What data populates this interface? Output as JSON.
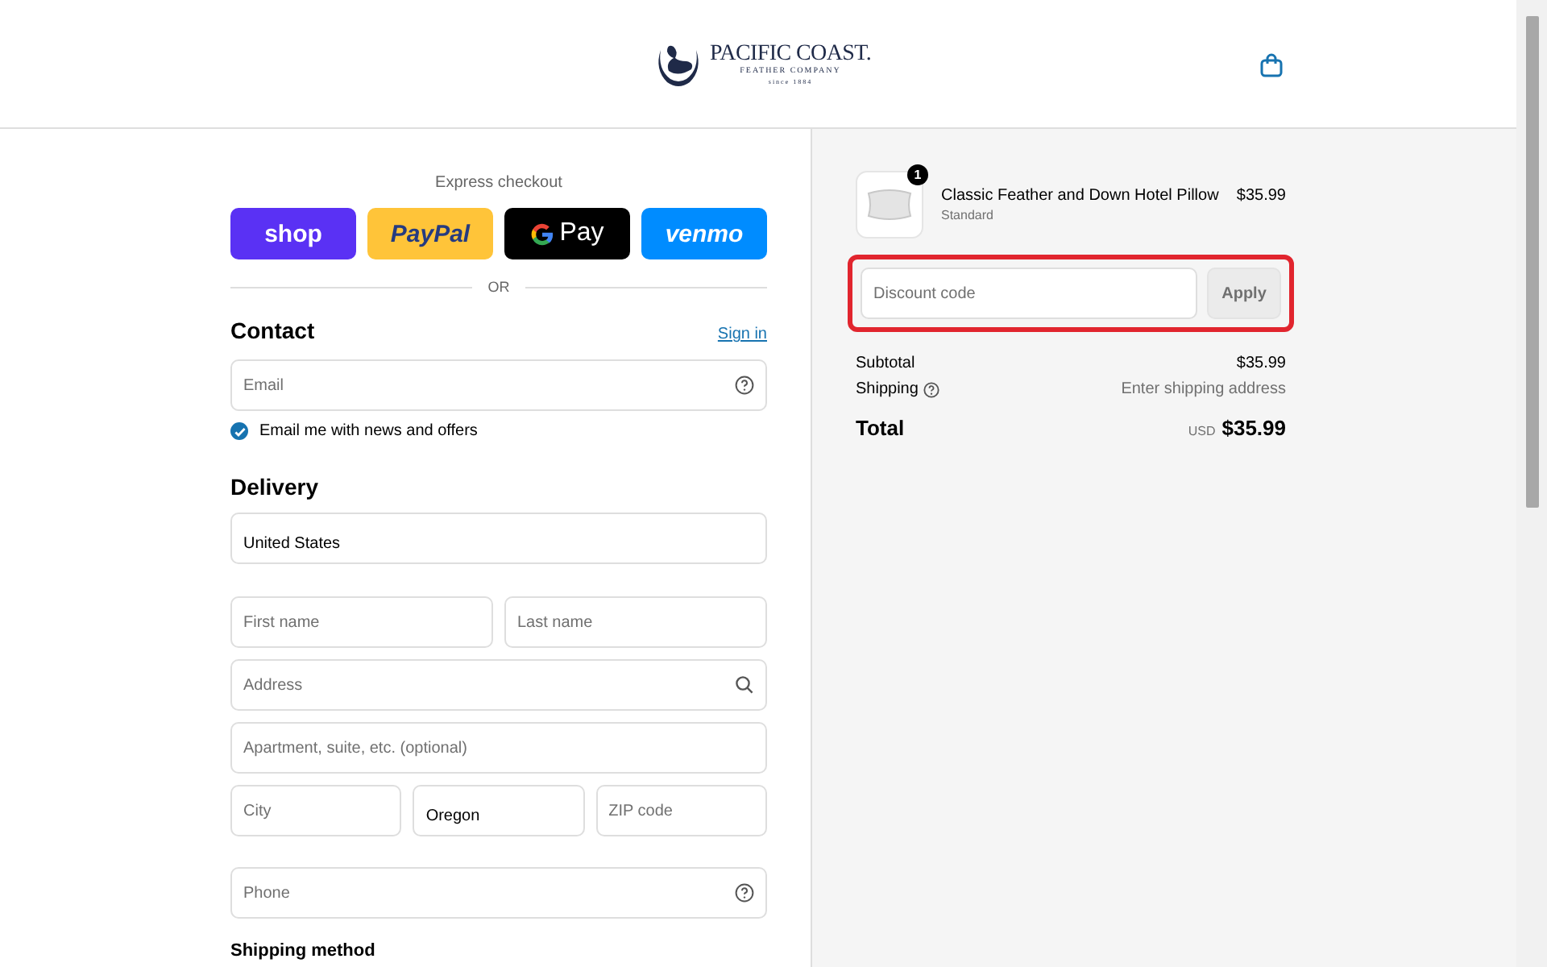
{
  "header": {
    "logo": {
      "name": "PACIFIC COAST.",
      "subtitle": "FEATHER COMPANY",
      "since": "since 1884"
    }
  },
  "express": {
    "label": "Express checkout",
    "buttons": [
      {
        "kind": "shop",
        "label": "shop"
      },
      {
        "kind": "paypal",
        "label": "PayPal"
      },
      {
        "kind": "gpay",
        "label": "Pay"
      },
      {
        "kind": "venmo",
        "label": "venmo"
      }
    ],
    "divider": "OR"
  },
  "contact": {
    "title": "Contact",
    "link": "Sign in",
    "email": {
      "kind": "help_input",
      "placeholder": "Email"
    },
    "newsletter": {
      "label": "Email me with news and offers",
      "checked": true
    }
  },
  "delivery": {
    "title": "Delivery",
    "rows": [
      [
        {
          "kind": "select",
          "value": "United States"
        }
      ],
      [
        {
          "kind": "input",
          "placeholder": "First name"
        },
        {
          "kind": "input",
          "placeholder": "Last name"
        }
      ],
      [
        {
          "kind": "search_input",
          "placeholder": "Address"
        }
      ],
      [
        {
          "kind": "input",
          "placeholder": "Apartment, suite, etc. (optional)"
        }
      ],
      [
        {
          "kind": "input",
          "placeholder": "City"
        },
        {
          "kind": "select",
          "value": "Oregon"
        },
        {
          "kind": "input",
          "placeholder": "ZIP code"
        }
      ],
      [
        {
          "kind": "help_input",
          "placeholder": "Phone"
        }
      ]
    ]
  },
  "shipping_method": {
    "title": "Shipping method"
  },
  "summary": {
    "item": {
      "name": "Classic Feather and Down Hotel Pillow",
      "variant": "Standard",
      "price": "$35.99",
      "quantity": "1"
    },
    "discount": {
      "placeholder": "Discount code",
      "button": "Apply"
    },
    "subtotal": {
      "label": "Subtotal",
      "value": "$35.99"
    },
    "shipping": {
      "label": "Shipping",
      "value": "Enter shipping address"
    },
    "total": {
      "label": "Total",
      "currency": "USD",
      "value": "$35.99"
    }
  }
}
